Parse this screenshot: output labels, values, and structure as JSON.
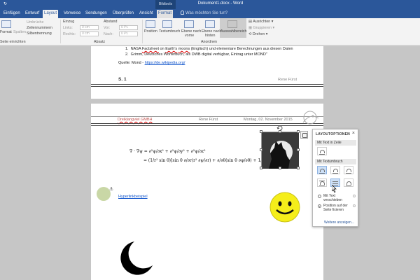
{
  "titlebar": {
    "quick": "↻",
    "context_group": "Bildtools",
    "doc_title": "Dokument1.docx - Word"
  },
  "tabs": [
    {
      "label": "Einfügen"
    },
    {
      "label": "Entwurf"
    },
    {
      "label": "Layout"
    },
    {
      "label": "Verweise"
    },
    {
      "label": "Sendungen"
    },
    {
      "label": "Überprüfen"
    },
    {
      "label": "Ansicht"
    },
    {
      "label": "Format"
    }
  ],
  "tell_me": "Was möchten Sie tun?",
  "ribbon": {
    "format": "Format",
    "spalten": "Spalten",
    "umbrueche": "Umbrüche",
    "zeilennummern": "Zeilennummern",
    "silbentrennung": "Silbentrennung",
    "einzug_label": "Einzug",
    "links": "Links:",
    "rechts": "Rechts:",
    "links_val": "0 cm",
    "rechts_val": "0 cm",
    "abstand_label": "Abstand",
    "vor": "Vor:",
    "nach": "Nach:",
    "vor_val": "0 Pt.",
    "nach_val": "0 Pt.",
    "position": "Position",
    "textumbruch": "Textumbruch",
    "ebene_vorne_1": "Ebene nach",
    "ebene_vorne_2": "vorne",
    "ebene_hinten_1": "Ebene nach",
    "ebene_hinten_2": "hinten",
    "auswahlbereich": "Auswahlbereich",
    "ausrichten": "Ausrichten",
    "gruppieren": "Gruppieren",
    "drehen": "Drehen",
    "group_seite": "Seite einrichten",
    "group_absatz": "Absatz",
    "group_anordnen": "Anordnen"
  },
  "page1": {
    "ref1_num": "1.",
    "ref1_a": "NASA ",
    "ref1_b": "Factsheet",
    "ref1_c": " on ",
    "ref1_d": "Earth's",
    "ref1_e": " ",
    "ref1_f": "moons",
    "ref1_g": " (Englisch) und elementare Berechnungen aus diesen Daten",
    "ref2_num": "2.",
    "ref2": "Grimm, Deutsches Wörterbuch, als DWB digital verfügbar, Eintrag unter MOND\"",
    "quelle_label": "Quelle: Mond - ",
    "quelle_link": "https://de.wikipedia.org/",
    "footer_left": "S. 1",
    "footer_right": "Rene Fürst"
  },
  "page2": {
    "hdr_company": "Dreiklangviel GMBH",
    "hdr_author": "Rene Fürst",
    "hdr_date": "Montag, 02. November 2015",
    "formula_lhs": "∇ · ∇ψ = ∂²ψ/∂x² + ∂²ψ/∂y² + ∂²ψ/∂z²",
    "formula_rhs": "= (1/r² sin θ)[sin θ ∂/∂r(r² ∂ψ/∂r) + ∂/∂θ(sin θ ∂ψ/∂θ) + 1/sin θ ∂²ψ/∂φ²]",
    "hyperlink_text": "Hyperlinkbeispiel"
  },
  "layout_panel": {
    "title": "LAYOUTOPTIONEN",
    "sec_inline": "Mit Text in Zeile",
    "sec_wrap": "Mit Textumbruch",
    "opt_move_1": "Mit Text",
    "opt_move_2": "verschieben",
    "opt_fix_1": "Position auf der",
    "opt_fix_2": "Seite fixieren",
    "more": "Weitere anzeigen..."
  },
  "colors": {
    "word_blue": "#2b579a",
    "smiley": "#f5ee1a",
    "circle": "#c9d7a6"
  }
}
